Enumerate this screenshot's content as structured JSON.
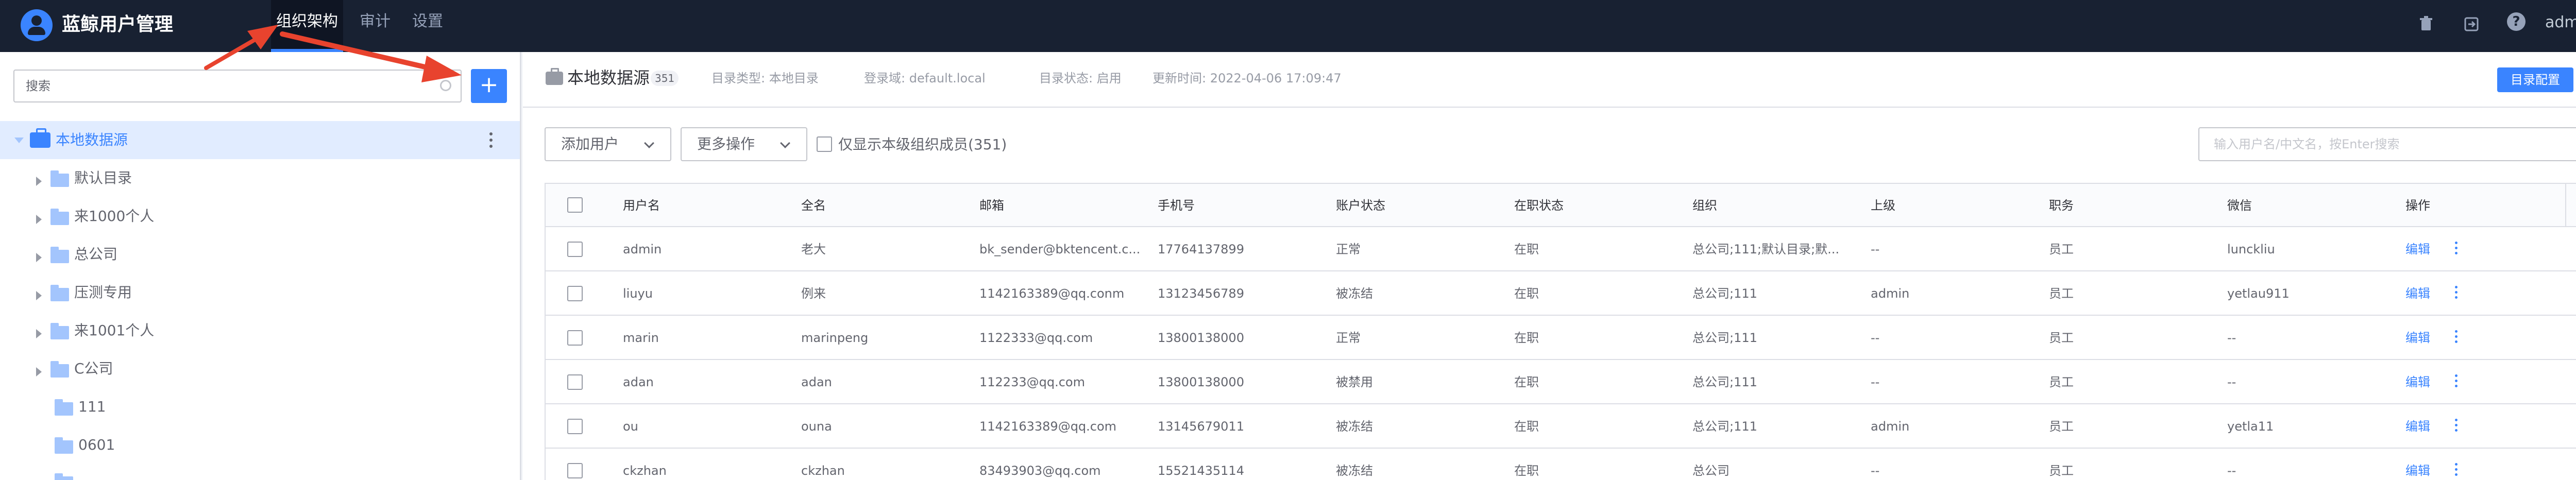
{
  "app": {
    "title": "蓝鲸用户管理"
  },
  "nav": [
    {
      "label": "组织架构",
      "active": true
    },
    {
      "label": "审计",
      "active": false
    },
    {
      "label": "设置",
      "active": false
    }
  ],
  "topbar": {
    "icons": [
      "trash-icon",
      "export-icon",
      "help-icon"
    ],
    "user": "admin"
  },
  "sidebar": {
    "search_placeholder": "搜索",
    "add_button": "+",
    "root": {
      "label": "本地数据源"
    },
    "items": [
      {
        "label": "默认目录",
        "expandable": true
      },
      {
        "label": "来1000个人",
        "expandable": true
      },
      {
        "label": "总公司",
        "expandable": true
      },
      {
        "label": "压测专用",
        "expandable": true
      },
      {
        "label": "来1001个人",
        "expandable": true
      },
      {
        "label": "C公司",
        "expandable": true
      },
      {
        "label": "111",
        "expandable": false
      },
      {
        "label": "0601",
        "expandable": false
      }
    ]
  },
  "header": {
    "title": "本地数据源",
    "count": "351",
    "dir_type": "目录类型: 本地目录",
    "login_domain": "登录域: default.local",
    "dir_status": "目录状态: 启用",
    "updated": "更新时间: 2022-04-06 17:09:47",
    "config_button": "目录配置"
  },
  "toolbar": {
    "add_user": "添加用户",
    "more_ops": "更多操作",
    "only_direct": "仅显示本级组织成员(351)",
    "search_placeholder": "输入用户名/中文名，按Enter搜索"
  },
  "table": {
    "columns": [
      "用户名",
      "全名",
      "邮箱",
      "手机号",
      "账户状态",
      "在职状态",
      "组织",
      "上级",
      "职务",
      "微信",
      "操作"
    ],
    "edit_label": "编辑",
    "rows": [
      [
        "admin",
        "老大",
        "bk_sender@bktencent.c...",
        "17764137899",
        "正常",
        "在职",
        "总公司;111;默认目录;默...",
        "--",
        "员工",
        "lunckliu"
      ],
      [
        "liuyu",
        "例来",
        "1142163389@qq.conm",
        "13123456789",
        "被冻结",
        "在职",
        "总公司;111",
        "admin",
        "员工",
        "yetlau911"
      ],
      [
        "marin",
        "marinpeng",
        "1122333@qq.com",
        "13800138000",
        "正常",
        "在职",
        "总公司;111",
        "--",
        "员工",
        "--"
      ],
      [
        "adan",
        "adan",
        "112233@qq.com",
        "13800138000",
        "被禁用",
        "在职",
        "总公司;111",
        "--",
        "员工",
        "--"
      ],
      [
        "ou",
        "ouna",
        "1142163389@qq.com",
        "13145679011",
        "被冻结",
        "在职",
        "总公司;111",
        "admin",
        "员工",
        "yetla11"
      ],
      [
        "ckzhan",
        "ckzhan",
        "83493903@qq.com",
        "15521435114",
        "被冻结",
        "在职",
        "总公司",
        "--",
        "员工",
        "--"
      ]
    ]
  },
  "colors": {
    "topbar": "#182132",
    "accent": "#3a84ff",
    "annotation": "#e8432e"
  }
}
